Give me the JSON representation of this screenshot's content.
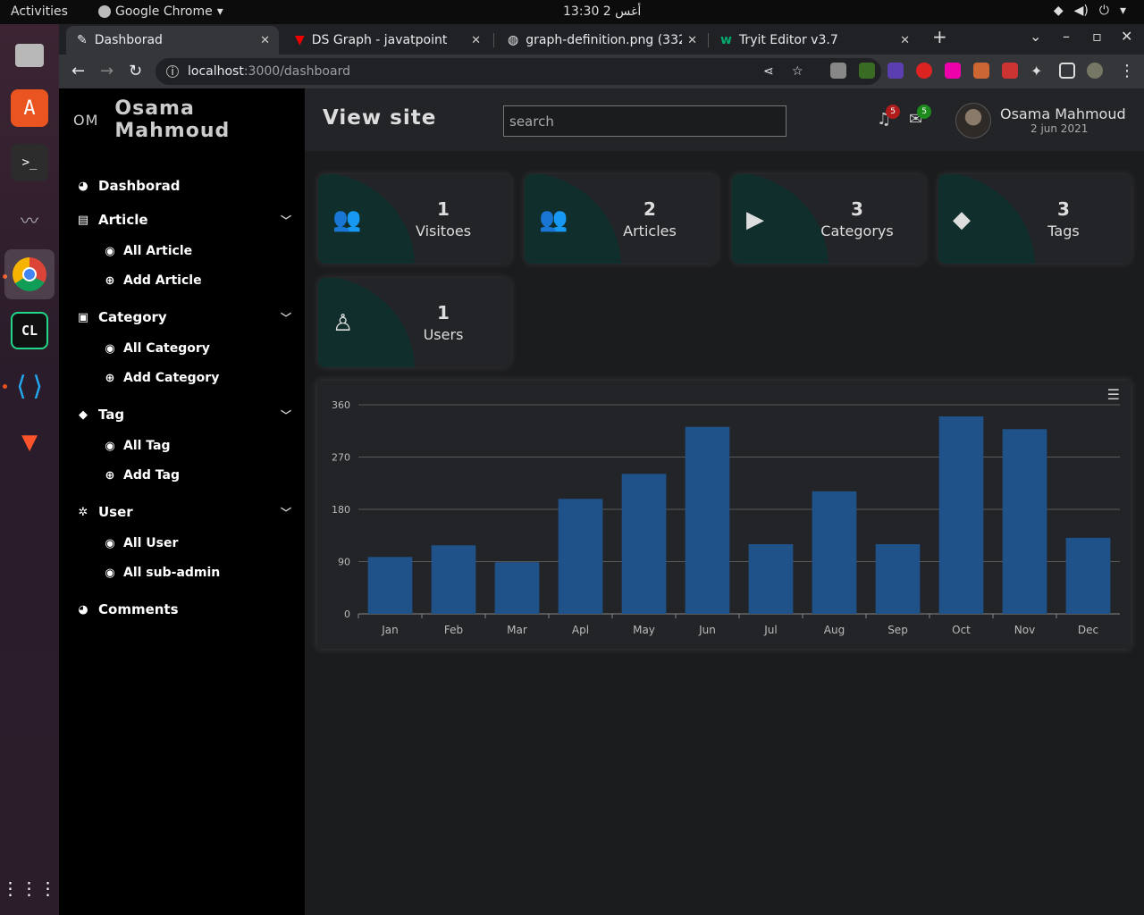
{
  "os": {
    "activities": "Activities",
    "app_name": "Google Chrome",
    "clock": "13:30  2 أغس"
  },
  "browser": {
    "tabs": [
      {
        "title": "Dashborad"
      },
      {
        "title": "DS Graph - javatpoint"
      },
      {
        "title": "graph-definition.png (332"
      },
      {
        "title": "Tryit Editor v3.7"
      }
    ],
    "url_host": "localhost",
    "url_path": ":3000/dashboard"
  },
  "brand": {
    "initials": "OM",
    "name": "Osama Mahmoud"
  },
  "header": {
    "view_site": "View site",
    "search_placeholder": "search",
    "notif_count": "5",
    "mail_count": "5",
    "user_name": "Osama Mahmoud",
    "user_date": "2 jun 2021"
  },
  "sidebar": {
    "dashboard": "Dashborad",
    "article": "Article",
    "all_article": "All Article",
    "add_article": "Add Article",
    "category": "Category",
    "all_category": "All Category",
    "add_category": "Add Category",
    "tag": "Tag",
    "all_tag": "All Tag",
    "add_tag": "Add Tag",
    "user": "User",
    "all_user": "All User",
    "all_subadmin": "All sub-admin",
    "comments": "Comments"
  },
  "cards": [
    {
      "value": "1",
      "label": "Visitoes",
      "icon": "users-icon"
    },
    {
      "value": "2",
      "label": "Articles",
      "icon": "users-icon"
    },
    {
      "value": "3",
      "label": "Categorys",
      "icon": "play-square-icon"
    },
    {
      "value": "3",
      "label": "Tags",
      "icon": "tag-icon"
    },
    {
      "value": "1",
      "label": "Users",
      "icon": "user-icon"
    }
  ],
  "chart_data": {
    "type": "bar",
    "categories": [
      "Jan",
      "Feb",
      "Mar",
      "Apl",
      "May",
      "Jun",
      "Jul",
      "Aug",
      "Sep",
      "Oct",
      "Nov",
      "Dec"
    ],
    "values": [
      98,
      118,
      89,
      198,
      241,
      322,
      120,
      211,
      120,
      340,
      318,
      131
    ],
    "ylim": [
      0,
      360
    ],
    "yticks": [
      0,
      90,
      180,
      270,
      360
    ],
    "bar_color": "#1f5289",
    "grid": true
  }
}
